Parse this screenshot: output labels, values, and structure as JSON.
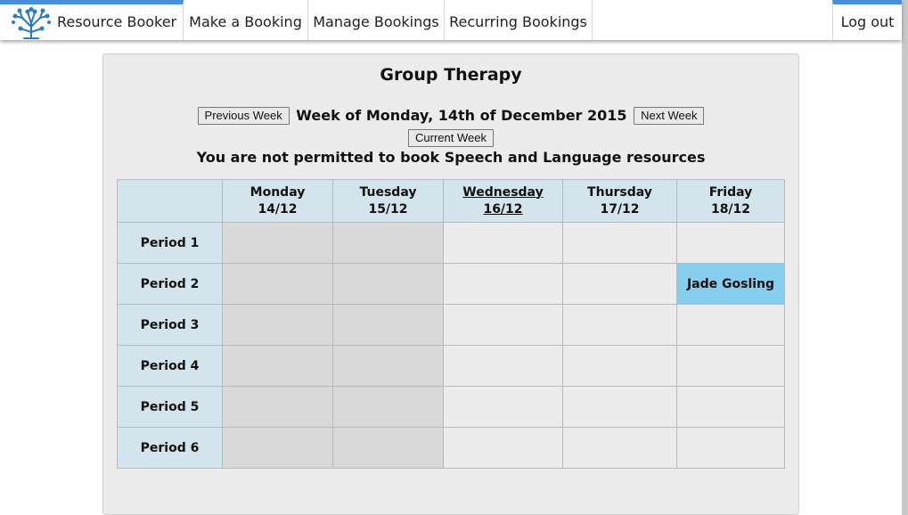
{
  "nav": {
    "brand": "Resource Booker",
    "make": "Make a Booking",
    "manage": "Manage Bookings",
    "recurring": "Recurring Bookings",
    "logout": "Log out",
    "accent": "#4a90d9",
    "logo_icon": "tree-icon"
  },
  "panel": {
    "title": "Group Therapy",
    "prev_button": "Previous Week",
    "week_label": "Week of Monday, 14th of December 2015",
    "next_button": "Next Week",
    "current_button": "Current Week",
    "notice": "You are not permitted to book Speech and Language resources"
  },
  "schedule": {
    "days": [
      {
        "name": "Monday",
        "date": "14/12"
      },
      {
        "name": "Tuesday",
        "date": "15/12"
      },
      {
        "name": "Wednesday",
        "date": "16/12"
      },
      {
        "name": "Thursday",
        "date": "17/12"
      },
      {
        "name": "Friday",
        "date": "18/12"
      }
    ],
    "periods": [
      "Period 1",
      "Period 2",
      "Period 3",
      "Period 4",
      "Period 5",
      "Period 6"
    ],
    "bookings": [
      {
        "period": "Period 2",
        "day": "Friday",
        "label": "Jade Gosling"
      }
    ],
    "colors": {
      "header": "#d4e4ec",
      "past": "#d9d9d9",
      "free": "#ececec",
      "booked": "#87cded"
    }
  }
}
